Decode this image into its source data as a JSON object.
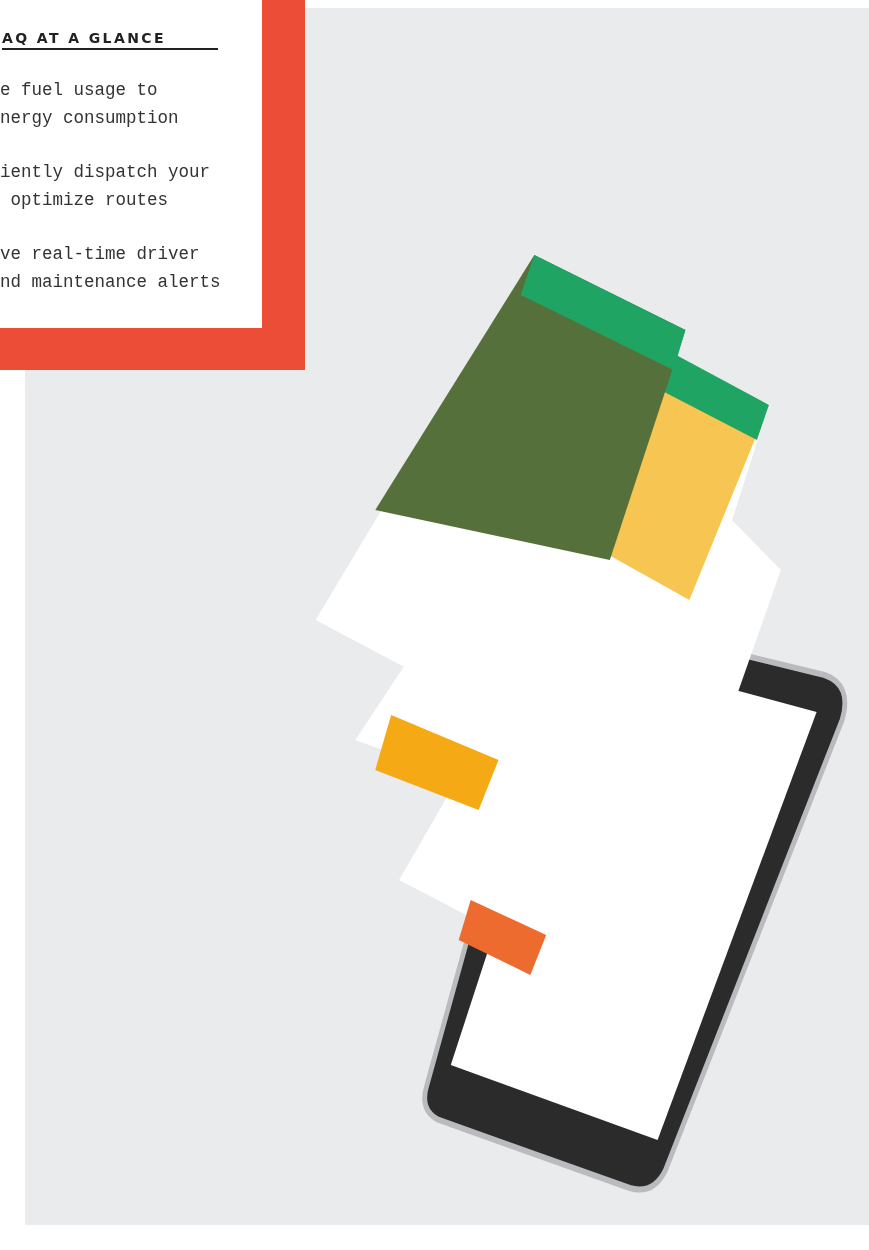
{
  "feature_card": {
    "heading": "AQ AT A GLANCE",
    "bullets": [
      "e fuel usage to\nnergy consumption",
      "iently dispatch your\n optimize routes",
      "ve real-time driver\nnd maintenance alerts"
    ]
  }
}
